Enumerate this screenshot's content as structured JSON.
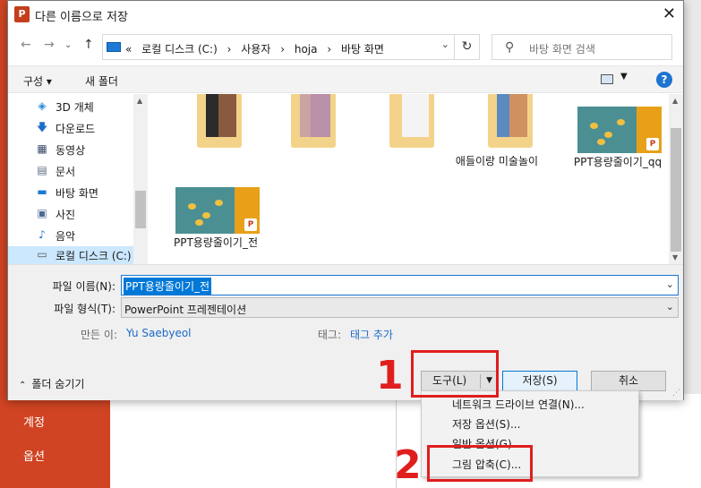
{
  "background": {
    "menu_items": [
      "계정",
      "옵션"
    ]
  },
  "dialog": {
    "title": "다른 이름으로 저장",
    "address_parts": [
      "«",
      "로컬 디스크 (C:)",
      "›",
      "사용자",
      "›",
      "hoja",
      "›",
      "바탕 화면"
    ],
    "search_placeholder": "바탕 화면 검색",
    "toolbar": {
      "organize": "구성 ▾",
      "new_folder": "새 폴더"
    },
    "nav_items": [
      {
        "label": "3D 개체",
        "icon": "cube-icon"
      },
      {
        "label": "다운로드",
        "icon": "download-icon"
      },
      {
        "label": "동영상",
        "icon": "video-icon"
      },
      {
        "label": "문서",
        "icon": "document-icon"
      },
      {
        "label": "바탕 화면",
        "icon": "desktop-icon"
      },
      {
        "label": "사진",
        "icon": "picture-icon"
      },
      {
        "label": "음악",
        "icon": "music-icon"
      },
      {
        "label": "로컬 디스크 (C:)",
        "icon": "drive-icon"
      }
    ],
    "files": [
      {
        "label": "",
        "kind": "folder"
      },
      {
        "label": "",
        "kind": "folder"
      },
      {
        "label": "",
        "kind": "folder"
      },
      {
        "label": "애들이랑 미술놀이",
        "kind": "folder"
      },
      {
        "label": "PPT용량줄이기_qq",
        "kind": "pptx"
      },
      {
        "label": "PPT용량줄이기_전",
        "kind": "pptx"
      }
    ],
    "filename_label": "파일 이름(N):",
    "filename_value": "PPT용량줄이기_전",
    "filetype_label": "파일 형식(T):",
    "filetype_value": "PowerPoint 프레젠테이션",
    "author_label": "만든 이:",
    "author_value": "Yu Saebyeol",
    "tags_label": "태그:",
    "tags_value": "태그 추가",
    "hide_folders": "폴더 숨기기",
    "tools_button": "도구(L)",
    "save_button": "저장(S)",
    "cancel_button": "취소"
  },
  "tools_menu": [
    "네트워크 드라이브 연결(N)...",
    "저장 옵션(S)...",
    "일반 옵션(G)...",
    "그림 압축(C)..."
  ],
  "annotations": {
    "step1": "1",
    "step2": "2",
    "color": "#e01e1e"
  },
  "colors": {
    "powerpoint_red": "#d04423",
    "accent_blue": "#0078d7"
  }
}
